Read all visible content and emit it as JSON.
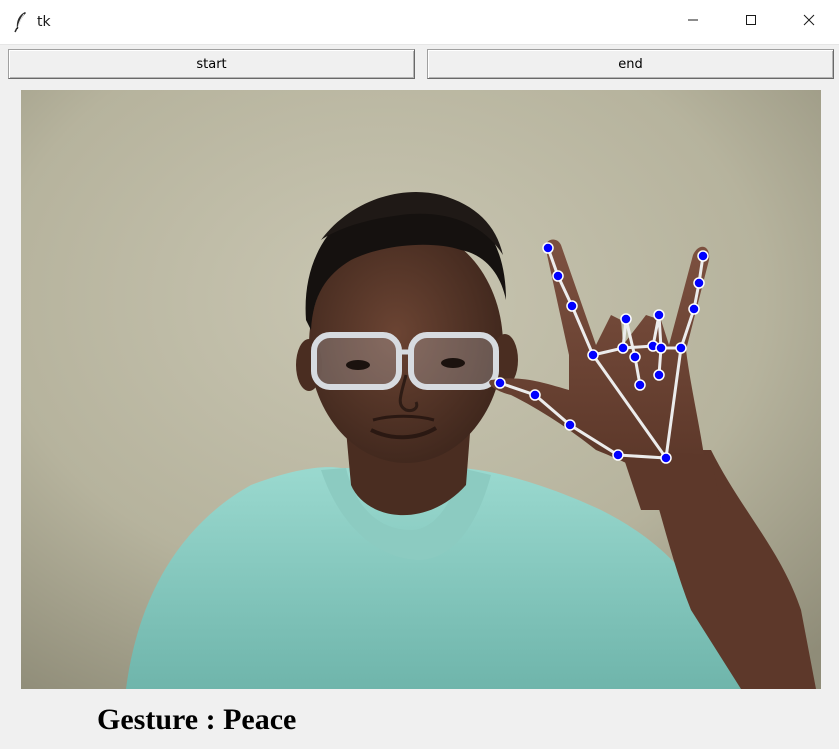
{
  "window": {
    "title": "tk",
    "icon": "feather-icon",
    "controls": [
      "minimize-icon",
      "maximize-icon",
      "close-icon"
    ]
  },
  "toolbar": {
    "start_label": "start",
    "end_label": "end"
  },
  "video": {
    "content": "webcam-feed",
    "hand_landmark_color": "#0000ff",
    "hand_connection_color": "#ffffff"
  },
  "gesture": {
    "prefix": "Gesture",
    "separator": ":",
    "value": "Peace"
  }
}
